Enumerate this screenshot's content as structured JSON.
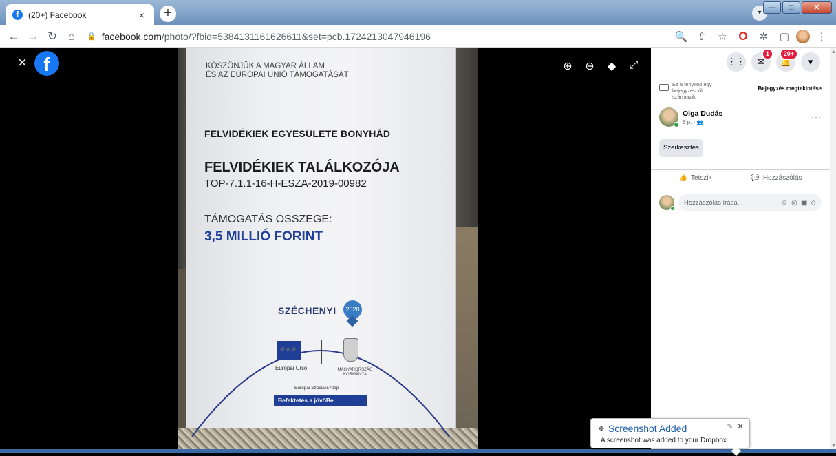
{
  "browser": {
    "tab_title": "(20+) Facebook",
    "tab_close": "×",
    "new_tab": "+",
    "url_host": "facebook.com",
    "url_path": "/photo/?fbid=5384131161626611&set=pcb.1724213047946196",
    "window_min": "—",
    "window_max": "□",
    "window_close": "✕"
  },
  "viewer": {
    "close": "×",
    "fb_logo": "f",
    "tools": [
      "zoom-in",
      "zoom-out",
      "tag",
      "fullscreen"
    ]
  },
  "board": {
    "thanks_line1": "KÖSZÖNJÜK A MAGYAR ÁLLAM",
    "thanks_line2": "ÉS AZ EURÓPAI UNIÓ TÁMOGATÁSÁT",
    "association": "FELVIDÉKIEK EGYESÜLETE BONYHÁD",
    "event": "FELVIDÉKIEK TALÁLKOZÓJA",
    "code": "TOP-7.1.1-16-H-ESZA-2019-00982",
    "support_label": "TÁMOGATÁS ÖSSZEGE:",
    "amount": "3,5 MILLIÓ FORINT",
    "szechenyi": "SZÉCHENYI",
    "szechenyi_year": "2020",
    "eu": "Európai Unió",
    "gov_line1": "MAGYARORSZÁG",
    "gov_line2": "KORMÁNYA",
    "esf": "Európai Szociális Alap",
    "invest": "Befektetés a jövőBe"
  },
  "panel": {
    "messenger_badge": "1",
    "notif_badge": "20+",
    "origin_text": "Ez a fénykép egy bejegyzésből származik.",
    "origin_link": "Bejegyzés megtekintése",
    "author_name": "Olga Dudás",
    "author_time": "6 p. · 👥",
    "more": "···",
    "edit_button": "Szerkesztés",
    "like": "Tetszik",
    "comment": "Hozzászólás",
    "comment_placeholder": "Hozzászólás írása..."
  },
  "toast": {
    "title": "Screenshot Added",
    "message": "A screenshot was added to your Dropbox.",
    "close": "✕"
  },
  "colors": {
    "facebook_blue": "#1877f2",
    "badge_red": "#e41e3f",
    "amount_blue": "#21409a",
    "dropbox_blue": "#1f5fa6"
  }
}
